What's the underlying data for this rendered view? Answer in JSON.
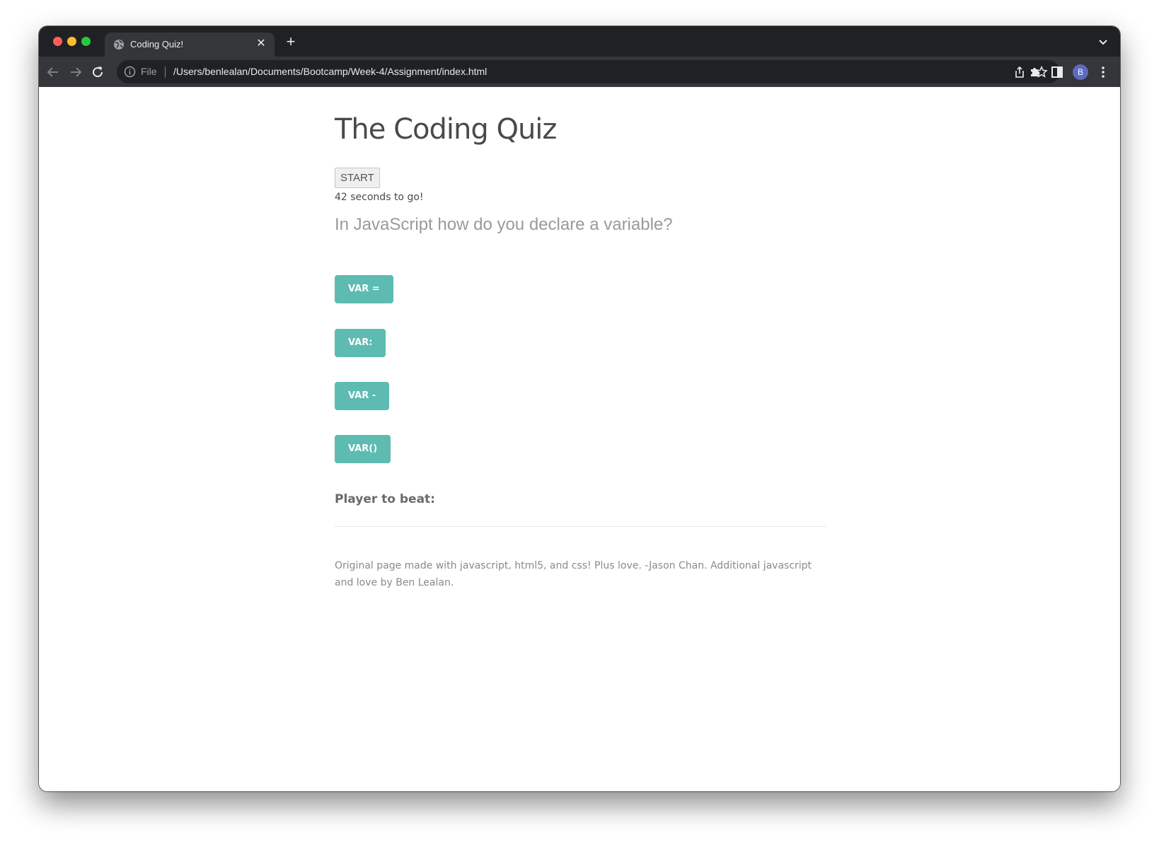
{
  "browser": {
    "tab": {
      "title": "Coding Quiz!"
    },
    "omnibox": {
      "scheme_label": "File",
      "url": "/Users/benlealan/Documents/Bootcamp/Week-4/Assignment/index.html"
    },
    "profile_initial": "B"
  },
  "page": {
    "title": "The Coding Quiz",
    "start_label": "START",
    "timer_text": "42 seconds to go!",
    "question": "In JavaScript how do you declare a variable?",
    "answers": [
      "VAR =",
      "VAR:",
      "VAR -",
      "VAR()"
    ],
    "answer_color": "#5dbbb2",
    "player_to_beat_label": "Player to beat:",
    "footer": "Original page made with javascript, html5, and css! Plus love. -Jason Chan. Additional javascript and love by Ben Lealan."
  },
  "icons": {
    "tab_favicon": "globe-icon",
    "tab_close": "close-icon",
    "new_tab": "plus-icon",
    "tab_search": "chevron-down-icon",
    "back": "arrow-left-icon",
    "forward": "arrow-right-icon",
    "reload": "reload-icon",
    "site_info": "info-icon",
    "share": "share-icon",
    "bookmark": "star-icon",
    "extensions": "puzzle-icon",
    "side_panel": "side-panel-icon",
    "menu": "kebab-menu-icon"
  }
}
